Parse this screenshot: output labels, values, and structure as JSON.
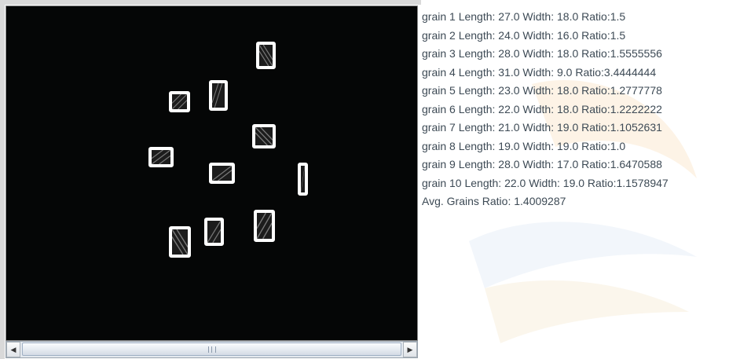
{
  "results": {
    "lines": [
      "grain 1  Length: 27.0  Width: 18.0  Ratio:1.5",
      "grain 2  Length: 24.0  Width: 16.0  Ratio:1.5",
      "grain 3  Length: 28.0  Width: 18.0  Ratio:1.5555556",
      "grain 4  Length: 31.0  Width: 9.0  Ratio:3.4444444",
      "grain 5  Length: 23.0  Width: 18.0  Ratio:1.2777778",
      "grain 6  Length: 22.0  Width: 18.0  Ratio:1.2222222",
      "grain 7  Length: 21.0  Width: 19.0  Ratio:1.1052631",
      "grain 8  Length: 19.0  Width: 19.0  Ratio:1.0",
      "grain 9  Length: 28.0  Width: 17.0  Ratio:1.6470588",
      "grain 10  Length: 22.0  Width: 19.0  Ratio:1.1578947",
      "Avg. Grains Ratio: 1.4009287"
    ]
  },
  "icons": {
    "scroll_left": "arrow-left-icon",
    "scroll_right": "arrow-right-icon"
  },
  "colors": {
    "image_background": "#050606",
    "grain_outline": "#ffffff",
    "text": "#3d4a55"
  }
}
